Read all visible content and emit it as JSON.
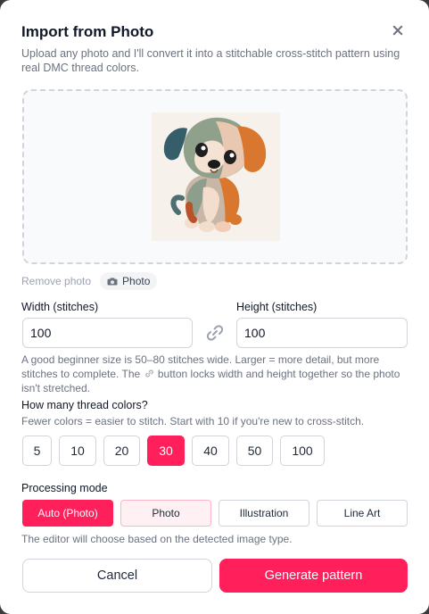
{
  "dialog": {
    "title": "Import from Photo",
    "subtitle": "Upload any photo and I'll convert it into a stitchable cross-stitch pattern using real DMC thread colors."
  },
  "upload": {
    "preview_alt": "Cartoon puppy",
    "remove_label": "Remove photo",
    "chip_label": "Photo",
    "chip_icon": "camera-icon"
  },
  "dimensions": {
    "width_label": "Width (stitches)",
    "width_value": "100",
    "height_label": "Height (stitches)",
    "height_value": "100",
    "link_icon": "link-icon",
    "help_before": "A good beginner size is 50–80 stitches wide. Larger = more detail, but more stitches to complete. The ",
    "help_after": " button locks width and height together so the photo isn't stretched."
  },
  "colors": {
    "question": "How many thread colors?",
    "hint": "Fewer colors = easier to stitch. Start with 10 if you're new to cross-stitch.",
    "options": [
      "5",
      "10",
      "20",
      "30",
      "40",
      "50",
      "100"
    ],
    "selected": "30"
  },
  "mode": {
    "label": "Processing mode",
    "options": [
      "Auto (Photo)",
      "Photo",
      "Illustration",
      "Line Art"
    ],
    "selected": "Auto (Photo)",
    "detected": "Photo",
    "help": "The editor will choose based on the detected image type."
  },
  "actions": {
    "cancel": "Cancel",
    "generate": "Generate pattern"
  },
  "theme": {
    "accent": "#ff1f5a",
    "accent_light": "#fff1f3"
  }
}
